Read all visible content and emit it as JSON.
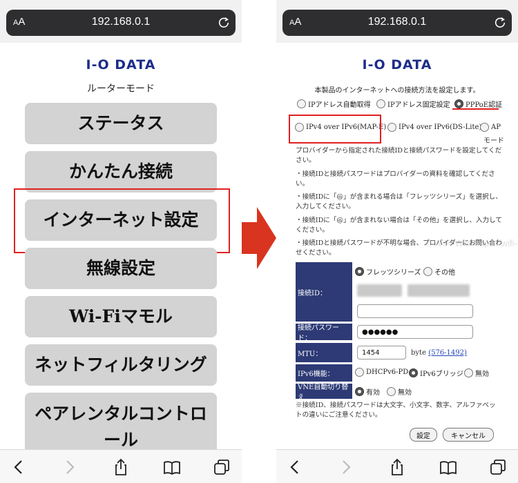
{
  "browser": {
    "aa_label_small": "A",
    "aa_label_large": "A",
    "url": "192.168.0.1"
  },
  "brand": {
    "logo_text": "I-O DATA"
  },
  "left": {
    "mode_label": "ルーターモード",
    "menu": [
      {
        "label": "ステータス"
      },
      {
        "label": "かんたん接続"
      },
      {
        "label": "インターネット設定"
      },
      {
        "label": "無線設定"
      },
      {
        "label": "Wi-Fiマモル"
      },
      {
        "label": "ネットフィルタリング"
      },
      {
        "label": "ペアレンタルコントロール"
      }
    ]
  },
  "right": {
    "intro": "本製品のインターネットへの接続方法を設定します。",
    "methods": [
      {
        "label": "IPアドレス自動取得",
        "selected": false
      },
      {
        "label": "IPアドレス固定設定",
        "selected": false
      },
      {
        "label": "PPPoE認証",
        "selected": true
      },
      {
        "label": "IPv4 over IPv6(MAP-E)",
        "selected": false
      },
      {
        "label": "IPv4 over IPv6(DS-Lite)",
        "selected": false
      },
      {
        "label": "AP",
        "selected": false
      },
      {
        "label": "モード",
        "selected": false
      }
    ],
    "notes": [
      "プロバイダーから指定された接続IDと接続パスワードを設定してください。",
      "・接続IDと接続パスワードはプロバイダーの資料を確認してください。",
      "・接続IDに「@」が含まれる場合は「フレッツシリーズ」を選択し、入力してください。",
      "・接続IDに「@」が含まれない場合は「その他」を選択し、入力してください。",
      "・接続IDと接続パスワードが不明な場合、プロバイダーにお問い合わせください。"
    ],
    "form": {
      "id_label": "接続ID：",
      "id_type_options": [
        {
          "label": "フレッツシリーズ",
          "selected": true
        },
        {
          "label": "その他",
          "selected": false
        }
      ],
      "password_label": "接続パスワード：",
      "password_value": "●●●●●●",
      "mtu_label": "MTU：",
      "mtu_value": "1454",
      "mtu_unit": "byte",
      "mtu_range": "(576-1492)",
      "ipv6_label": "IPv6機能：",
      "ipv6_options": [
        {
          "label": "DHCPv6-PD",
          "selected": false
        },
        {
          "label": "IPv6ブリッジ",
          "selected": true
        },
        {
          "label": "無効",
          "selected": false
        }
      ],
      "vne_label": "VNE自動切り替え",
      "vne_options": [
        {
          "label": "有効",
          "selected": true
        },
        {
          "label": "無効",
          "selected": false
        }
      ],
      "footnote": "※接続ID、接続パスワードは大文字、小文字、数字、アルファベットの違いにご注意ください。",
      "save_button": "設定",
      "cancel_button": "キャンセル"
    }
  },
  "watermark": "© WiFi-Wiki https://wifi-..."
}
